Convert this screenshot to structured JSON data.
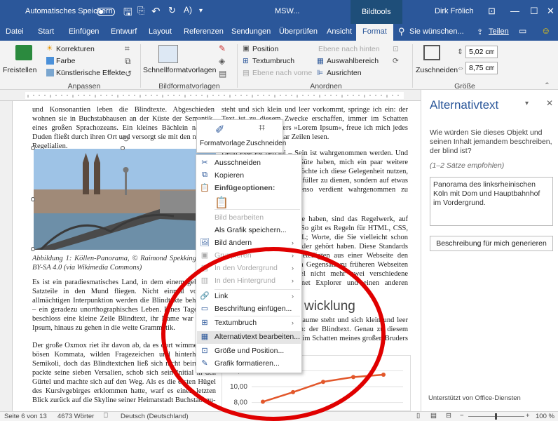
{
  "titlebar": {
    "autosave": "Automatisches Speichern",
    "doc_title": "MSW...",
    "context_label": "Bildtools",
    "user": "Dirk Frölich"
  },
  "tabs": [
    "Datei",
    "Start",
    "Einfügen",
    "Entwurf",
    "Layout",
    "Referenzen",
    "Sendungen",
    "Überprüfen",
    "Ansicht",
    "Format"
  ],
  "tell_me": "Sie wünschen...",
  "share": "Teilen",
  "ribbon": {
    "freistellen": "Freistellen",
    "korrekturen": "Korrekturen",
    "farbe": "Farbe",
    "effekte": "Künstlerische Effekte",
    "anpassen": "Anpassen",
    "schnellformat": "Schnellformatvorlagen",
    "bildformat": "Bildformatvorlagen",
    "position": "Position",
    "textumbruch": "Textumbruch",
    "ebene_vorne": "Ebene nach vorne",
    "ebene_hinten": "Ebene nach hinten",
    "auswahl": "Auswahlbereich",
    "ausrichten": "Ausrichten",
    "anordnen": "Anordnen",
    "zuschneiden": "Zuschneiden",
    "height": "5,02 cm",
    "width": "8,75 cm",
    "groesse": "Größe"
  },
  "document": {
    "p1": "und Konsonantien leben die Blindtexte. Abgeschieden wohnen sie in Buchstabhausen an der Küste der Semantik, eines großen Sprachozeans. Ein kleines Bächlein namens Duden fließt durch ihren Ort und versorgt sie mit den nötigen Regelialien.",
    "p2": "steht und sich klein und leer vorkommt, springe ich ein: der Text ist zu diesem Zwecke erschaffen, immer im Schatten meines großen Bruders »Lorem Ipsum«, freue ich mich jedes Mal, wenn Sie ein paar Zeilen lesen.",
    "p3": "Denn esse est percipi – Sein ist wahrgenommen werden. Und weil Sie nun schon die Güte haben, mich ein paar weitere Sätze lang zu begleiten, möchte ich diese Gelegenheit nutzen, Ihnen nicht nur als Lückenfüller zu dienen, sondern auf etwas hinzuweisen, das es ebenso verdient wahrgenommen zu werden:",
    "p4": "Webstandards nämlich. Sie haben, sind das Regelwerk, auf dem Webseiten aufbauen. So gibt es Regeln für HTML, CSS, JavaScript oder auch XML; Worte, die Sie vielleicht schon einmal von Ihrem Entwickler gehört haben. Diese Standards sorgen dafür, dass alle Beteiligten aus einer Webseite den größten Nutzen ziehen. Im Gegensatz zu früheren Webseiten müssen wir zum Beispiel nicht mehr zwei verschiedene Webseiten für den Internet Explorer und einen anderen Browser programmieren.",
    "caption": "Abbildung 1: Köllen-Panorama, © Raimond Spekking / CC-BY-SA 4.0 (via Wikimedia Commons)",
    "p5": "Es ist ein paradiesmatisches Land, in dem einem gebratene Satzteile in den Mund fliegen. Nicht einmal von der allmächtigen Interpunktion werden die Blindtexte beherrscht – ein geradezu unorthographisches Leben. Eines Tages aber beschloss eine kleine Zeile Blindtext, ihr Name war Lorem Ipsum, hinaus zu gehen in die weite Grammatik.",
    "heading": "wicklung",
    "p6": "Wenn ein Text nackt im Raume steht und sich klein und leer vorkommt, springe ich ein: der Blindtext. Genau zu diesem Zwecke erschaffen, immer im Schatten meines großen Bruders »Lorem Ipsum«.",
    "p7": "Der große Oxmox riet ihr davon ab, da es dort wimmele von bösen Kommata, wilden Fragezeichen und hinterhältigen Semikoli, doch das Blindtextchen ließ sich nicht beirren. Es packte seine sieben Versalien, schob sich sein Initial in den Gürtel und machte sich auf den Weg. Als es die ersten Hügel des Kursivgebirges erklommen hatte, warf es einen letzten Blick zurück auf die Skyline seiner Heimatstadt Buchstabhau-"
  },
  "chart_data": {
    "type": "line",
    "y_ticks": [
      "12,00",
      "10,00",
      "8,00"
    ],
    "ylim": [
      7,
      13
    ],
    "series": [
      {
        "values": [
          8.1,
          9.3,
          10.6,
          11.2,
          11.5
        ]
      }
    ],
    "color": "#e2572b"
  },
  "minitoolbar": {
    "formatvorlage": "Formatvorlage",
    "zuschneiden": "Zuschneiden"
  },
  "context_menu": [
    {
      "label": "Ausschneiden",
      "icon": "scissors-icon",
      "glyph": "✂",
      "disabled": false
    },
    {
      "label": "Kopieren",
      "icon": "copy-icon",
      "glyph": "⧉",
      "disabled": false
    },
    {
      "label": "Einfügeoptionen:",
      "icon": "paste-icon",
      "glyph": "📋",
      "disabled": false,
      "header": true
    },
    {
      "label": "Bild bearbeiten",
      "icon": "",
      "glyph": "",
      "disabled": true
    },
    {
      "label": "Als Grafik speichern...",
      "icon": "",
      "glyph": "",
      "disabled": false
    },
    {
      "label": "Bild ändern",
      "icon": "change-picture-icon",
      "glyph": "🖼",
      "disabled": false,
      "submenu": true
    },
    {
      "label": "Gruppieren",
      "icon": "group-icon",
      "glyph": "▣",
      "disabled": true,
      "submenu": true
    },
    {
      "label": "In den Vordergrund",
      "icon": "bring-forward-icon",
      "glyph": "▤",
      "disabled": true,
      "submenu": true
    },
    {
      "label": "In den Hintergrund",
      "icon": "send-backward-icon",
      "glyph": "▥",
      "disabled": true,
      "submenu": true
    },
    {
      "label": "Link",
      "icon": "link-icon",
      "glyph": "🔗",
      "disabled": false,
      "submenu": true
    },
    {
      "label": "Beschriftung einfügen...",
      "icon": "caption-icon",
      "glyph": "▭",
      "disabled": false
    },
    {
      "label": "Textumbruch",
      "icon": "wrap-text-icon",
      "glyph": "⊞",
      "disabled": false,
      "submenu": true
    },
    {
      "label": "Alternativtext bearbeiten...",
      "icon": "alt-text-icon",
      "glyph": "▦",
      "disabled": false,
      "highlight": true
    },
    {
      "label": "Größe und Position...",
      "icon": "size-position-icon",
      "glyph": "⊡",
      "disabled": false
    },
    {
      "label": "Grafik formatieren...",
      "icon": "format-picture-icon",
      "glyph": "✎",
      "disabled": false
    }
  ],
  "pane": {
    "title": "Alternativtext",
    "question": "Wie würden Sie dieses Objekt und seinen Inhalt jemandem beschreiben, der blind ist?",
    "hint": "(1–2 Sätze empfohlen)",
    "alt_text": "Panorama des linksrheinischen Köln mit Dom und Hauptbahnhof im Vordergrund.",
    "generate_btn": "Beschreibung für mich generieren",
    "footer": "Unterstützt von Office-Diensten"
  },
  "status": {
    "page": "Seite 6 von 13",
    "words": "4673 Wörter",
    "lang": "Deutsch (Deutschland)",
    "zoom": "100 %"
  },
  "colors": {
    "word_blue": "#2b579a",
    "highlight_red": "#e00000"
  }
}
